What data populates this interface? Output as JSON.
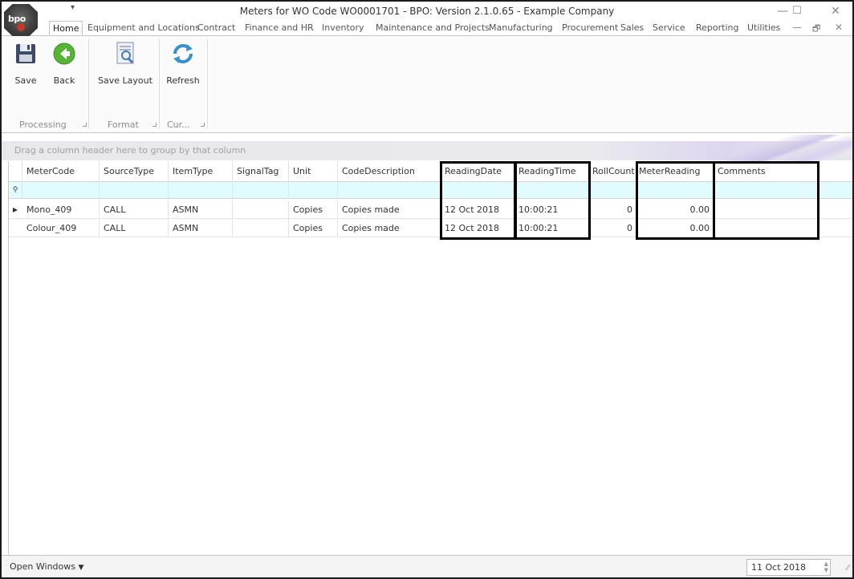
{
  "window": {
    "title": "Meters for WO Code WO0001701 - BPO: Version 2.1.0.65 - Example Company",
    "logo_text": "bpo",
    "minimize": "—",
    "maximize": "☐",
    "close": "✕"
  },
  "ribbon_tabs": [
    "Home",
    "Equipment and Locations",
    "Contract",
    "Finance and HR",
    "Inventory",
    "Maintenance and Projects",
    "Manufacturing",
    "Procurement",
    "Sales",
    "Service",
    "Reporting",
    "Utilities"
  ],
  "mdi_controls": {
    "minimize": "—",
    "restore": "🗗",
    "close": "✕"
  },
  "ribbon": {
    "save_label": "Save",
    "back_label": "Back",
    "save_layout_label": "Save Layout",
    "refresh_label": "Refresh",
    "groups": {
      "processing": "Processing",
      "format": "Format",
      "current": "Cur..."
    }
  },
  "group_panel_hint": "Drag a column header here to group by that column",
  "grid": {
    "columns": [
      "MeterCode",
      "SourceType",
      "ItemType",
      "SignalTag",
      "Unit",
      "CodeDescription",
      "ReadingDate",
      "ReadingTime",
      "RollCount",
      "MeterReading",
      "Comments"
    ],
    "rows": [
      {
        "MeterCode": "Mono_409",
        "SourceType": "CALL",
        "ItemType": "ASMN",
        "SignalTag": "",
        "Unit": "Copies",
        "CodeDescription": "Copies made",
        "ReadingDate": "12 Oct 2018",
        "ReadingTime": "10:00:21",
        "RollCount": "0",
        "MeterReading": "0.00",
        "Comments": ""
      },
      {
        "MeterCode": "Colour_409",
        "SourceType": "CALL",
        "ItemType": "ASMN",
        "SignalTag": "",
        "Unit": "Copies",
        "CodeDescription": "Copies made",
        "ReadingDate": "12 Oct 2018",
        "ReadingTime": "10:00:21",
        "RollCount": "0",
        "MeterReading": "0.00",
        "Comments": ""
      }
    ]
  },
  "statusbar": {
    "open_windows": "Open Windows",
    "date": "11 Oct 2018"
  }
}
